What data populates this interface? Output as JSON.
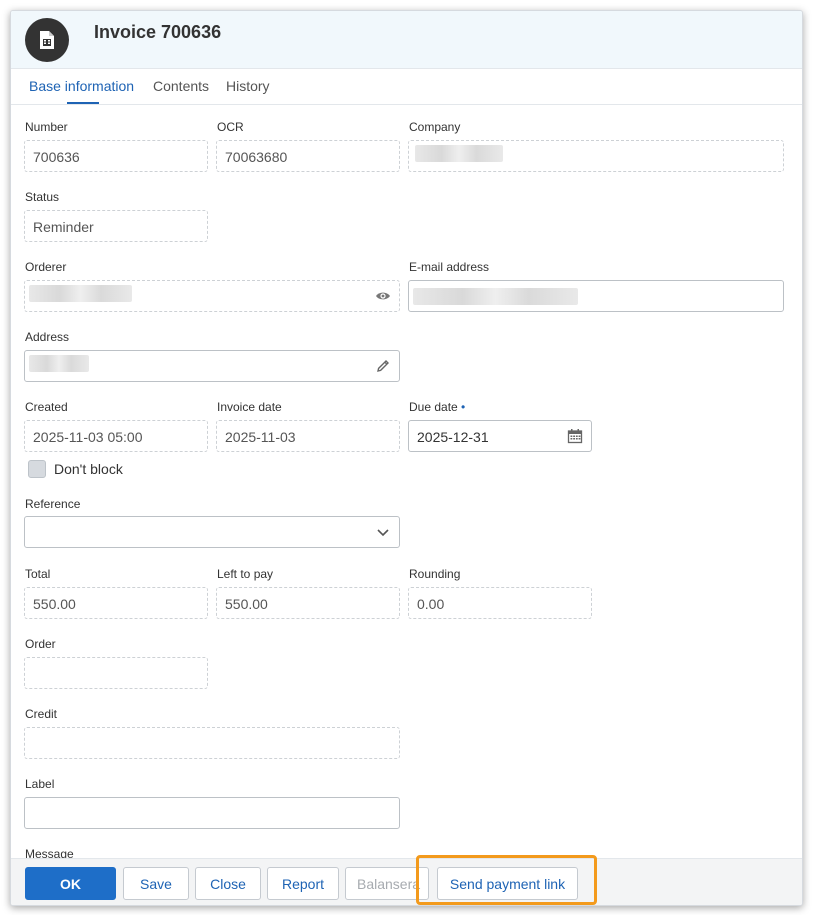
{
  "header": {
    "title": "Invoice 700636",
    "icon": "invoice-icon"
  },
  "tabs": [
    {
      "label": "Base information",
      "active": true
    },
    {
      "label": "Contents",
      "active": false
    },
    {
      "label": "History",
      "active": false
    }
  ],
  "fields": {
    "number": {
      "label": "Number",
      "value": "700636"
    },
    "ocr": {
      "label": "OCR",
      "value": "70063680"
    },
    "company": {
      "label": "Company"
    },
    "status": {
      "label": "Status",
      "value": "Reminder"
    },
    "orderer": {
      "label": "Orderer",
      "icon": "eye-icon"
    },
    "email": {
      "label": "E-mail address"
    },
    "address": {
      "label": "Address",
      "icon": "pencil-icon"
    },
    "created": {
      "label": "Created",
      "value": "2025-11-03 05:00"
    },
    "invoice_date": {
      "label": "Invoice date",
      "value": "2025-11-03"
    },
    "due_date": {
      "label": "Due date",
      "required_mark": "•",
      "value": "2025-12-31",
      "icon": "calendar-icon"
    },
    "dont_block": {
      "label": "Don't block",
      "checked": false
    },
    "reference": {
      "label": "Reference",
      "value": "",
      "icon": "chevron-down-icon"
    },
    "total": {
      "label": "Total",
      "value": "550.00"
    },
    "left_to_pay": {
      "label": "Left to pay",
      "value": "550.00"
    },
    "rounding": {
      "label": "Rounding",
      "value": "0.00"
    },
    "order": {
      "label": "Order",
      "value": ""
    },
    "credit": {
      "label": "Credit",
      "value": ""
    },
    "label_field": {
      "label": "Label",
      "value": ""
    },
    "message": {
      "label": "Message"
    }
  },
  "footer": {
    "ok": "OK",
    "save": "Save",
    "close": "Close",
    "report": "Report",
    "balansera": "Balansera",
    "send_payment_link": "Send payment link"
  },
  "colors": {
    "accent": "#1e63b4",
    "primary_button": "#1e6ec8",
    "highlight": "#f39a1c"
  }
}
